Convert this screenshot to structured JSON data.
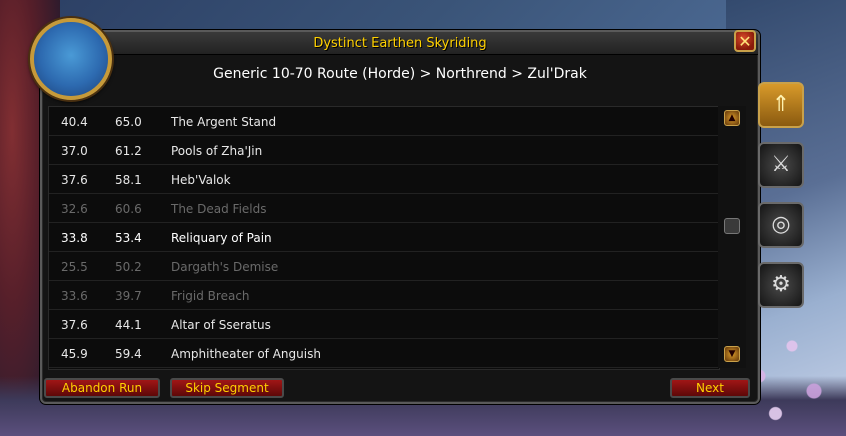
{
  "window": {
    "title": "Dystinct Earthen Skyriding",
    "close_label": "✕"
  },
  "breadcrumb": "Generic 10-70 Route (Horde) > Northrend > Zul'Drak",
  "rows": [
    {
      "x": "40.4",
      "y": "65.0",
      "name": "The Argent Stand",
      "state": "normal"
    },
    {
      "x": "37.0",
      "y": "61.2",
      "name": "Pools of Zha'Jin",
      "state": "normal"
    },
    {
      "x": "37.6",
      "y": "58.1",
      "name": "Heb'Valok",
      "state": "normal"
    },
    {
      "x": "32.6",
      "y": "60.6",
      "name": "The Dead Fields",
      "state": "dim"
    },
    {
      "x": "33.8",
      "y": "53.4",
      "name": "Reliquary of Pain",
      "state": "current"
    },
    {
      "x": "25.5",
      "y": "50.2",
      "name": "Dargath's Demise",
      "state": "dim"
    },
    {
      "x": "33.6",
      "y": "39.7",
      "name": "Frigid Breach",
      "state": "dim"
    },
    {
      "x": "37.6",
      "y": "44.1",
      "name": "Altar of Sseratus",
      "state": "normal"
    },
    {
      "x": "45.9",
      "y": "59.4",
      "name": "Amphitheater of Anguish",
      "state": "normal"
    }
  ],
  "buttons": {
    "abandon": "Abandon Run",
    "skip": "Skip Segment",
    "next": "Next"
  },
  "scrollbar": {
    "up_icon": "▲",
    "down_icon": "▼"
  },
  "side_tabs": [
    {
      "icon": "up-arrow-icon",
      "glyph": "⇑",
      "active": true
    },
    {
      "icon": "map-icon",
      "glyph": "⚔",
      "active": false
    },
    {
      "icon": "compass-icon",
      "glyph": "◎",
      "active": false
    },
    {
      "icon": "gear-icon",
      "glyph": "⚙",
      "active": false
    }
  ],
  "colors": {
    "title": "#ffd100",
    "button_text": "#ffd100",
    "button_bg": "#8a1010"
  }
}
